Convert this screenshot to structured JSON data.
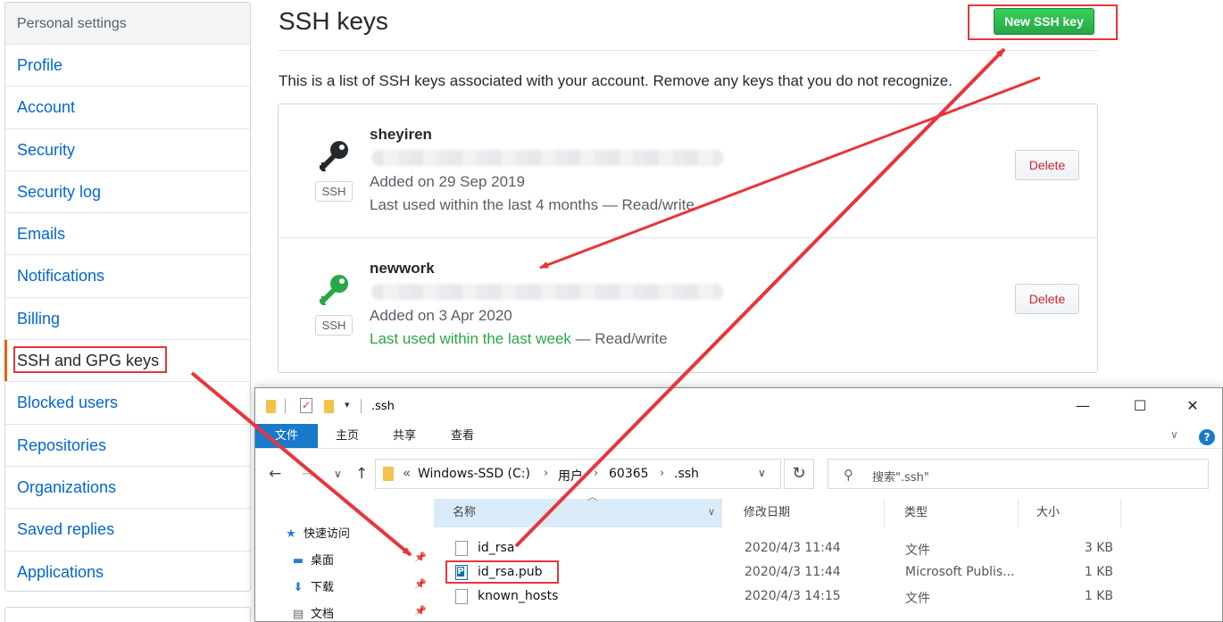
{
  "sidebar": {
    "header": "Personal settings",
    "items": [
      {
        "label": "Profile"
      },
      {
        "label": "Account"
      },
      {
        "label": "Security"
      },
      {
        "label": "Security log"
      },
      {
        "label": "Emails"
      },
      {
        "label": "Notifications"
      },
      {
        "label": "Billing"
      },
      {
        "label": "SSH and GPG keys",
        "selected": true
      },
      {
        "label": "Blocked users"
      },
      {
        "label": "Repositories"
      },
      {
        "label": "Organizations"
      },
      {
        "label": "Saved replies"
      },
      {
        "label": "Applications"
      }
    ]
  },
  "main": {
    "title": "SSH keys",
    "new_key_label": "New SSH key",
    "intro": "This is a list of SSH keys associated with your account. Remove any keys that you do not recognize.",
    "keys": [
      {
        "name": "sheyiren",
        "badge": "SSH",
        "added": "Added on 29 Sep 2019",
        "last_used": "Last used within the last 4 months",
        "access": " — Read/write",
        "delete_label": "Delete",
        "icon": "key-icon",
        "icon_color": "#24292e"
      },
      {
        "name": "newwork",
        "badge": "SSH",
        "added": "Added on 3 Apr 2020",
        "last_used": "Last used within the last week",
        "access": " — Read/write",
        "delete_label": "Delete",
        "icon": "key-icon",
        "icon_color": "#28a745"
      }
    ]
  },
  "explorer": {
    "title": ".ssh",
    "ribbon_tabs": [
      "文件",
      "主页",
      "共享",
      "查看"
    ],
    "address": [
      "Windows-SSD (C:)",
      "用户",
      "60365",
      ".ssh"
    ],
    "address_prefix": "«",
    "search_placeholder": "搜索\".ssh\"",
    "nav_items": [
      {
        "label": "快速访问",
        "icon": "star-icon"
      },
      {
        "label": "桌面",
        "icon": "desktop-icon"
      },
      {
        "label": "下载",
        "icon": "download-icon"
      },
      {
        "label": "文档",
        "icon": "document-icon"
      }
    ],
    "columns": [
      "名称",
      "修改日期",
      "类型",
      "大小"
    ],
    "files": [
      {
        "name": "id_rsa",
        "date": "2020/4/3 11:44",
        "type": "文件",
        "size": "3 KB"
      },
      {
        "name": "id_rsa.pub",
        "date": "2020/4/3 11:44",
        "type": "Microsoft Publis...",
        "size": "1 KB"
      },
      {
        "name": "known_hosts",
        "date": "2020/4/3 14:15",
        "type": "文件",
        "size": "1 KB"
      }
    ]
  },
  "colors": {
    "annotation": "#e8353a",
    "accent": "#0366d6",
    "success": "#28a745",
    "danger": "#cb2431"
  }
}
